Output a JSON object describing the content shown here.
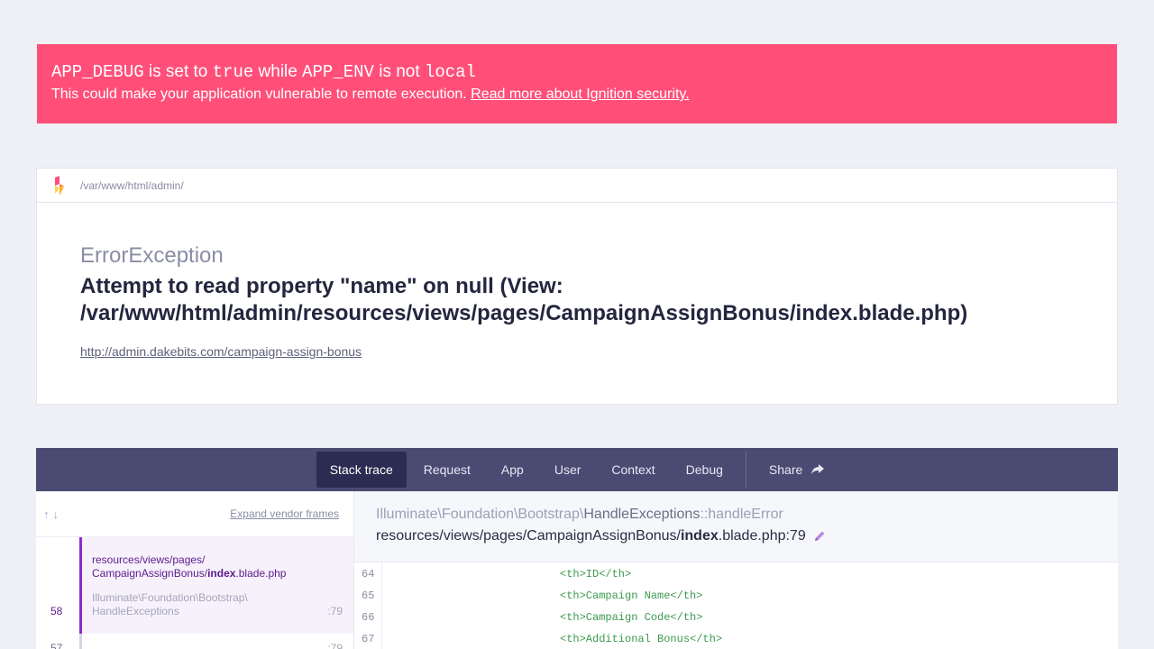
{
  "alert": {
    "debug_key": "APP_DEBUG",
    "is_set_to": " is set to ",
    "debug_value": "true",
    "while": " while ",
    "env_key": "APP_ENV",
    "is_not": " is not ",
    "env_value": "local",
    "message": "This could make your application vulnerable to remote execution. ",
    "link": "Read more about Ignition security."
  },
  "card": {
    "path": "/var/www/html/admin/",
    "exception_class": "ErrorException",
    "message_line1": "Attempt to read property \"name\" on null (View:",
    "message_line2": "/var/www/html/admin/resources/views/pages/CampaignAssignBonus/index.blade.php)",
    "url": "http://admin.dakebits.com/campaign-assign-bonus"
  },
  "tabs": [
    {
      "label": "Stack trace",
      "active": true
    },
    {
      "label": "Request"
    },
    {
      "label": "App"
    },
    {
      "label": "User"
    },
    {
      "label": "Context"
    },
    {
      "label": "Debug"
    }
  ],
  "share_label": "Share",
  "stack": {
    "expand_label": "Expand vendor frames",
    "frame": {
      "file_prefix": "resources/views/pages/",
      "file_dir": "CampaignAssignBonus/",
      "file_bold": "index",
      "file_suffix": ".blade.php",
      "class_line1": "Illuminate\\Foundation\\Bootstrap\\",
      "class_line2": "HandleExceptions",
      "number": "58",
      "line": ":79"
    },
    "next": {
      "number": "57",
      "line": ":79"
    }
  },
  "detail": {
    "class_prefix": "Illuminate\\Foundation\\Bootstrap\\",
    "class_name": "HandleExceptions",
    "method": "::handleError",
    "file_prefix": "resources/views/pages/CampaignAssignBonus/",
    "file_bold": "index",
    "file_suffix": ".blade.php:79"
  },
  "code": [
    {
      "n": "64",
      "t": "<th>ID</th>"
    },
    {
      "n": "65",
      "t": "<th>Campaign Name</th>"
    },
    {
      "n": "66",
      "t": "<th>Campaign Code</th>"
    },
    {
      "n": "67",
      "t": "<th>Additional Bonus</th>"
    }
  ]
}
